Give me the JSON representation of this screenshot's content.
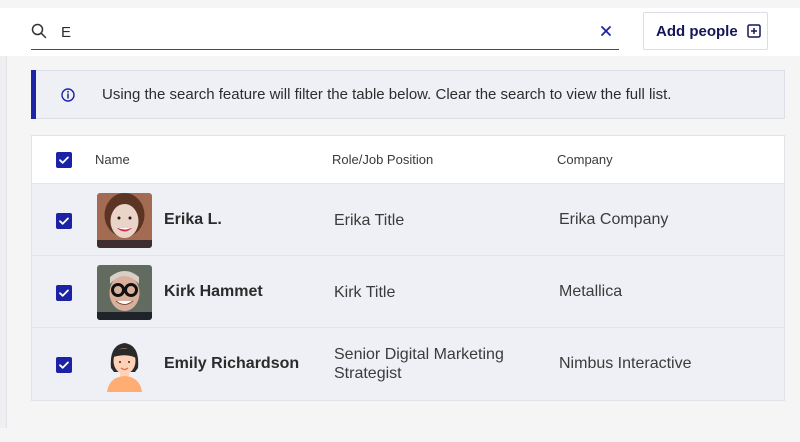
{
  "search": {
    "value": "E",
    "placeholder": ""
  },
  "actions": {
    "add_people_label": "Add people"
  },
  "banner": {
    "message": "Using the search feature will filter the table below. Clear the search to view the full list."
  },
  "table": {
    "columns": [
      "Name",
      "Role/Job Position",
      "Company"
    ],
    "rows": [
      {
        "name": "Erika L.",
        "role": "Erika Title",
        "company": "Erika Company",
        "selected": true,
        "avatar": "photo-avatar"
      },
      {
        "name": "Kirk Hammet",
        "role": "Kirk Title",
        "company": "Metallica",
        "selected": true,
        "avatar": "photo-avatar"
      },
      {
        "name": "Emily Richardson",
        "role": "Senior Digital Marketing Strategist",
        "company": "Nimbus Interactive",
        "selected": true,
        "avatar": "illustrated-avatar"
      }
    ],
    "select_all": true
  },
  "icons": {
    "search": "search-icon",
    "clear": "close-icon",
    "add": "plus-square-icon",
    "info": "info-icon",
    "checkbox": "check-icon"
  },
  "colors": {
    "accent": "#1d23a5",
    "banner_bg": "#eef0f6",
    "row_bg": "#eef0f6",
    "text": "#2d2d2d"
  }
}
